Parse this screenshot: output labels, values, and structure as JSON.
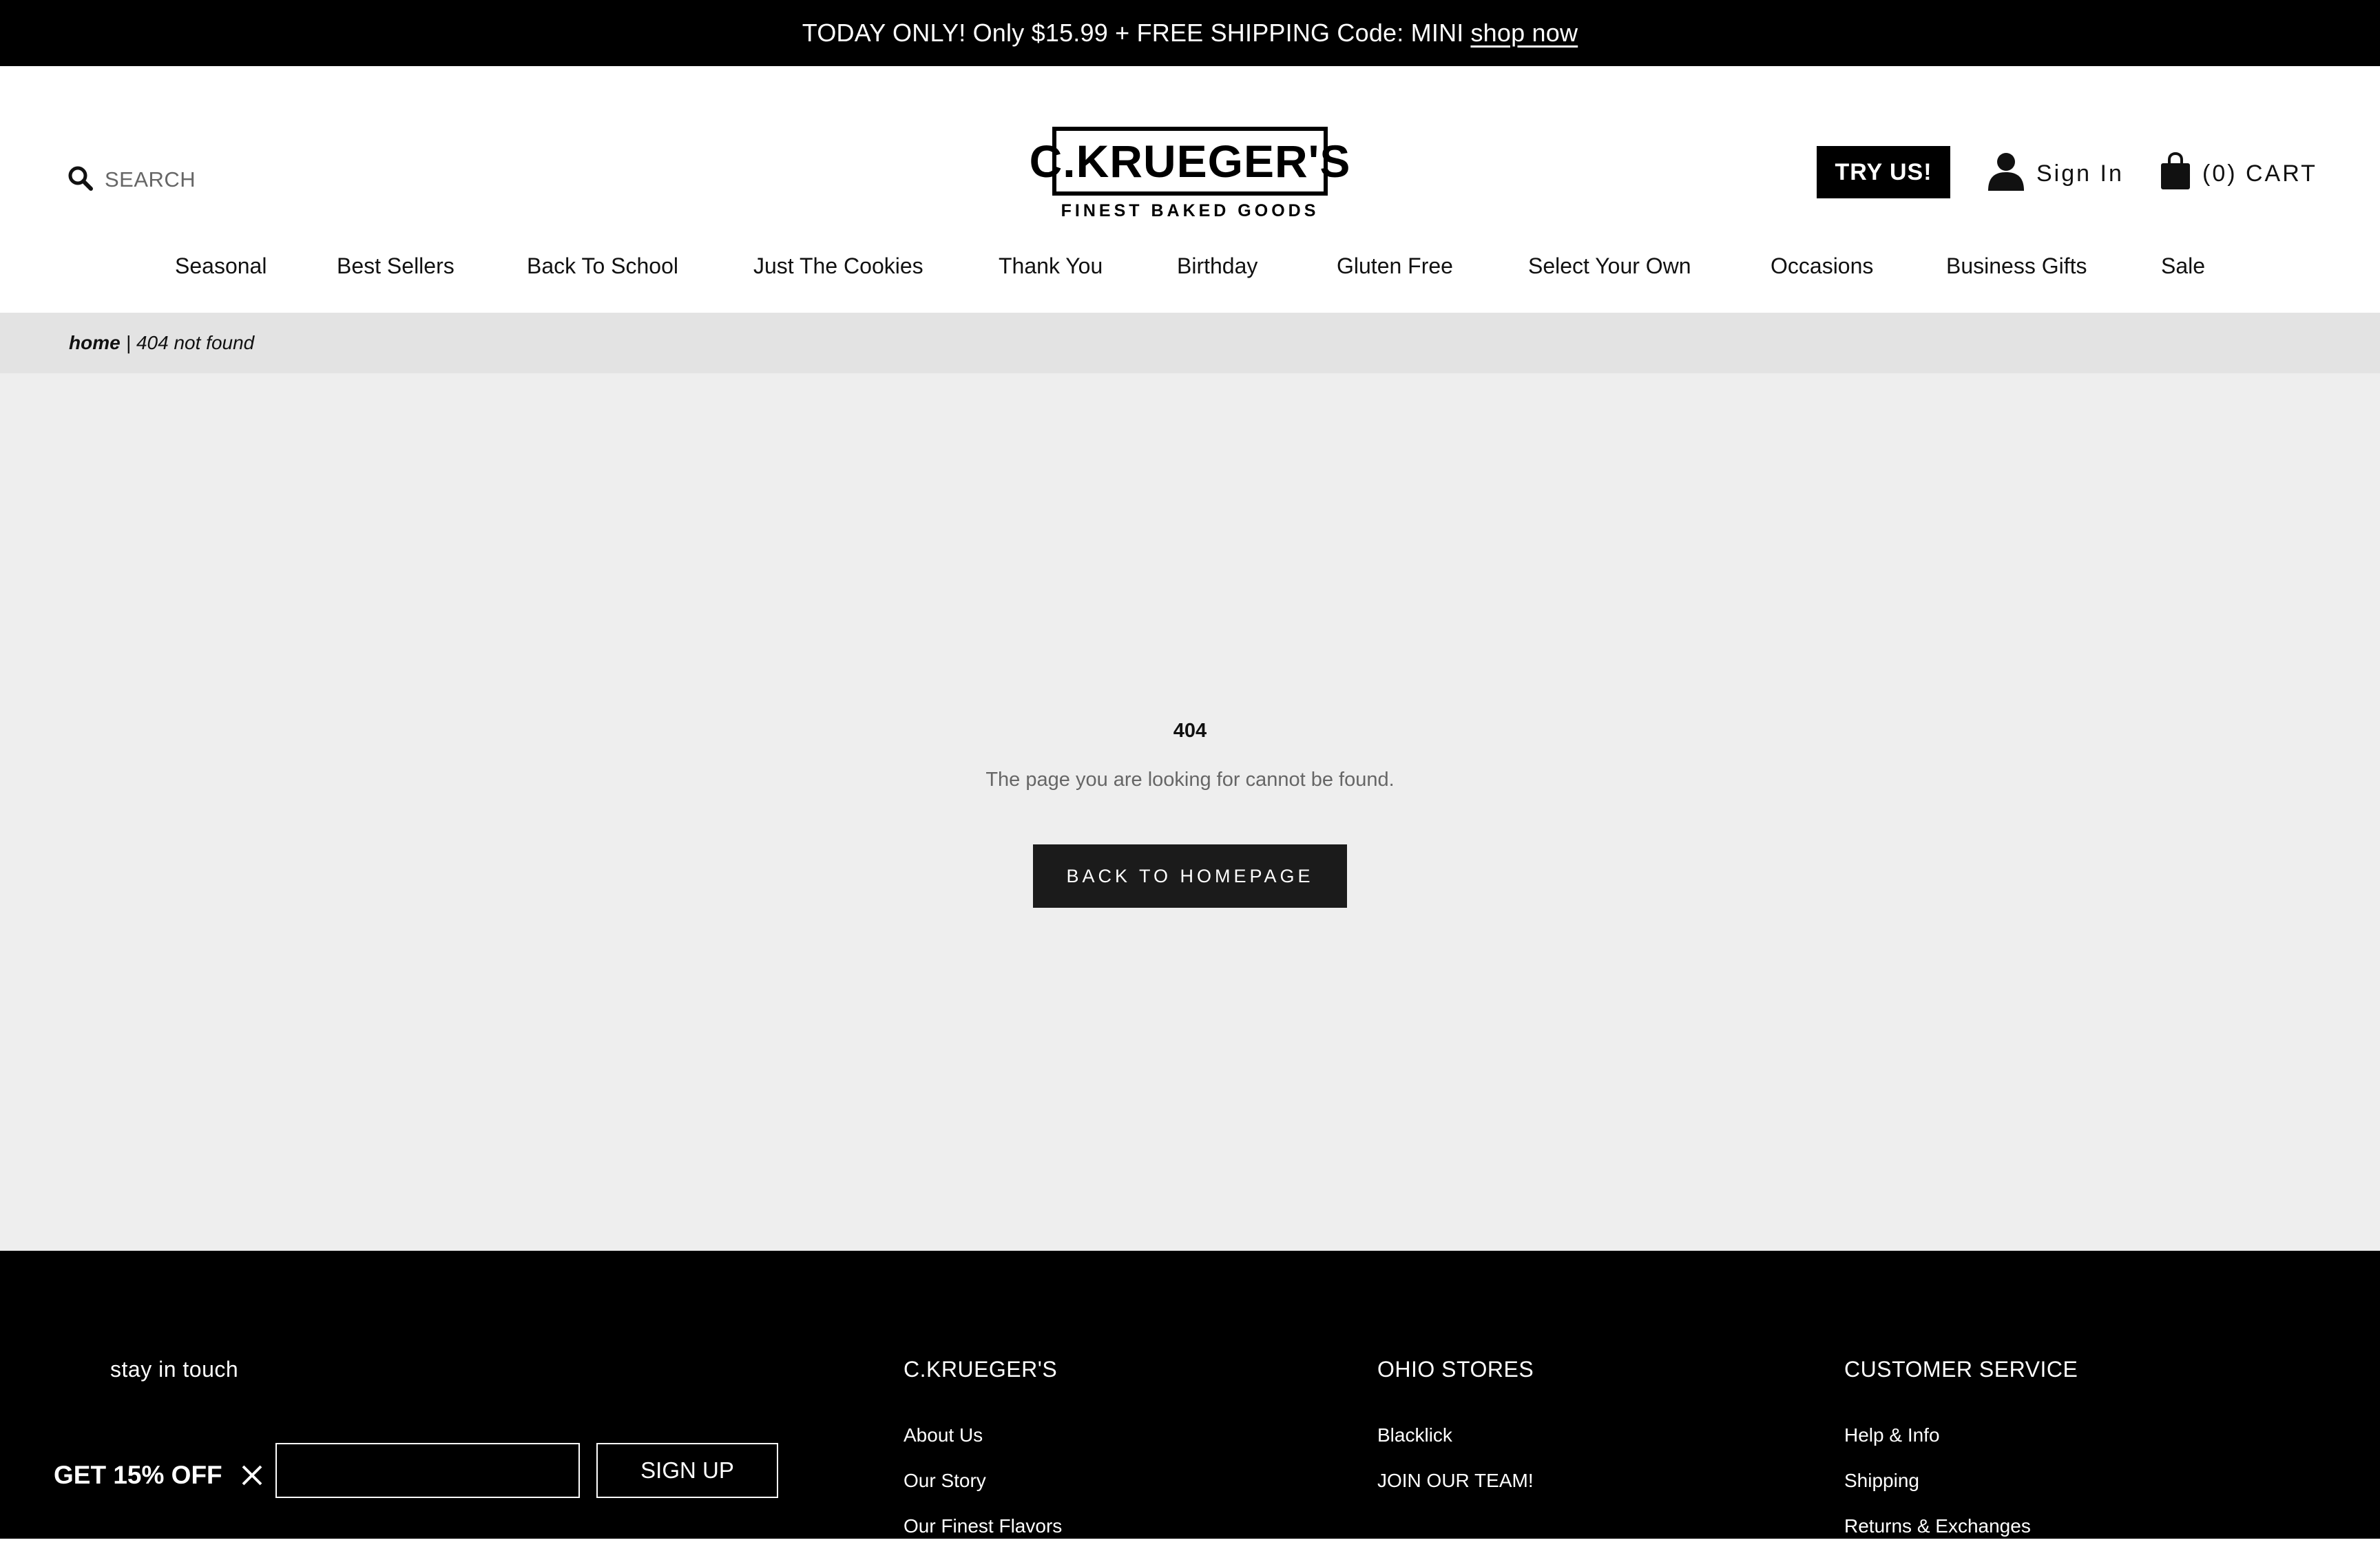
{
  "announcement": {
    "text": "TODAY ONLY! Only $15.99 + FREE SHIPPING Code: MINI",
    "link": "shop now"
  },
  "header": {
    "search_label": "SEARCH",
    "logo_name": "C.KRUEGER'S",
    "logo_tagline": "FINEST BAKED GOODS",
    "try_us": "TRY US!",
    "sign_in": "Sign In",
    "cart": "(0) CART"
  },
  "nav": {
    "items": [
      "Seasonal",
      "Best Sellers",
      "Back To School",
      "Just The Cookies",
      "Thank You",
      "Birthday",
      "Gluten Free",
      "Select Your Own",
      "Occasions",
      "Business Gifts",
      "Sale"
    ]
  },
  "breadcrumb": {
    "home": "home",
    "separator": "|",
    "current": "404 not found"
  },
  "main": {
    "code": "404",
    "message": "The page you are looking for cannot be found.",
    "button": "BACK TO HOMEPAGE"
  },
  "footer": {
    "stay_in_touch": "stay in touch",
    "signup_button": "SIGN UP",
    "promo": "GET 15% OFF",
    "columns": [
      {
        "title": "C.KRUEGER'S",
        "links": [
          "About Us",
          "Our Story",
          "Our Finest Flavors"
        ]
      },
      {
        "title": "OHIO STORES",
        "links": [
          "Blacklick",
          "JOIN OUR TEAM!"
        ]
      },
      {
        "title": "CUSTOMER SERVICE",
        "links": [
          "Help & Info",
          "Shipping",
          "Returns & Exchanges"
        ]
      }
    ]
  },
  "colors": {
    "black": "#000000",
    "page_bg": "#eeeeee",
    "breadcrumb_bg": "#e3e3e3",
    "button_dark": "#1b1b1b"
  },
  "icons": [
    "search-icon",
    "user-icon",
    "bag-icon",
    "close-icon"
  ]
}
